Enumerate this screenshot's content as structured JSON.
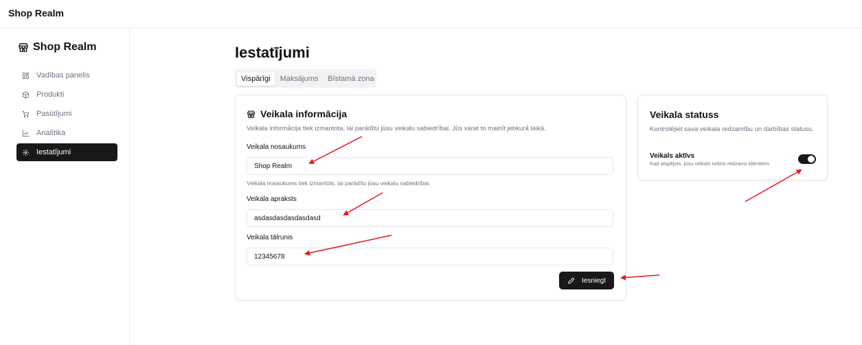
{
  "app": {
    "title": "Shop Realm"
  },
  "sidebar": {
    "brand": "Shop Realm",
    "items": [
      {
        "label": "Vadības panelis",
        "icon": "dashboard-icon"
      },
      {
        "label": "Produkti",
        "icon": "package-icon"
      },
      {
        "label": "Pasūtījumi",
        "icon": "cart-icon"
      },
      {
        "label": "Analītika",
        "icon": "chart-icon"
      },
      {
        "label": "Iestatījumi",
        "icon": "gear-icon",
        "active": true
      }
    ]
  },
  "page": {
    "title": "Iestatījumi",
    "tabs": [
      {
        "label": "Vispārīgi",
        "active": true
      },
      {
        "label": "Maksājums"
      },
      {
        "label": "Bīstamā zona"
      }
    ]
  },
  "store_info": {
    "heading": "Veikala informācija",
    "description": "Veikala informācija tiek izmantota, lai parādītu jūsu veikalu sabiedrībai. Jūs varat to mainīt jebkurā laikā.",
    "name_label": "Veikala nosaukums",
    "name_value": "Shop Realm",
    "name_help": "Veikala nosaukums tiek izmantots, lai parādītu jūsu veikalu sabiedrībai.",
    "description_label": "Veikala apraksts",
    "description_value": "asdasdasdasdasdasd",
    "phone_label": "Veikala tālrunis",
    "phone_value": "12345678",
    "submit_label": "Iesniegt"
  },
  "store_status": {
    "title": "Veikala statuss",
    "description": "Kontrolējiet sava veikala redzamību un darbības statusu.",
    "toggle_label": "Veikals aktīvs",
    "toggle_help": "Kad atspējots, jūsu veikals nebūs redzams klientiem.",
    "toggle_on": true
  },
  "colors": {
    "accent": "#18181b",
    "annotation_arrow": "#e8141b"
  }
}
